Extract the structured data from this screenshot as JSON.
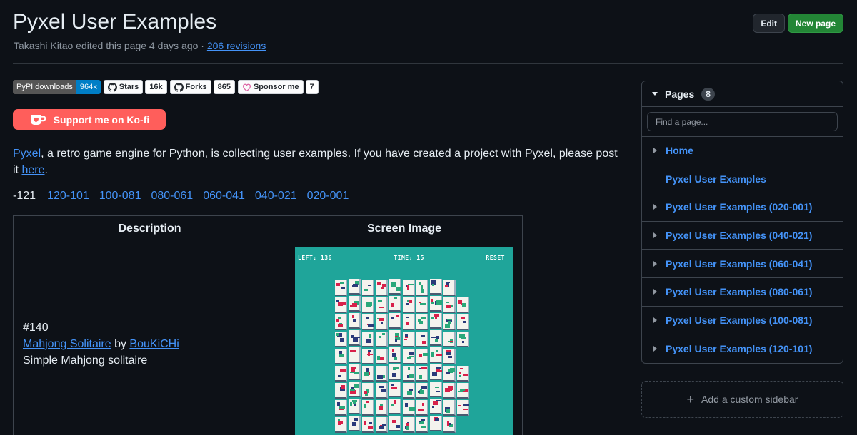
{
  "header": {
    "title": "Pyxel User Examples",
    "edited_by": "Takashi Kitao edited this page 4 days ago · ",
    "revisions": "206 revisions",
    "edit_label": "Edit",
    "new_page_label": "New page"
  },
  "badges": {
    "pypi_label": "PyPI downloads",
    "pypi_value": "964k",
    "stars_label": "Stars",
    "stars_count": "16k",
    "forks_label": "Forks",
    "forks_count": "865",
    "sponsor_label": "Sponsor me",
    "sponsor_count": "7"
  },
  "kofi": {
    "label": "Support me on Ko-fi",
    "color": "#ff5e5b"
  },
  "intro": {
    "link": "Pyxel",
    "text": ", a retro game engine for Python, is collecting user examples. If you have created a project with Pyxel, please post it ",
    "here": "here",
    "end": "."
  },
  "range_nav": {
    "current": "-121",
    "links": [
      "120-101",
      "100-081",
      "080-061",
      "060-041",
      "040-021",
      "020-001"
    ]
  },
  "table": {
    "headers": [
      "Description",
      "Screen Image"
    ],
    "rows": [
      {
        "number": "#140",
        "title": "Mahjong Solitaire",
        "by": " by ",
        "author": "BouKiCHi",
        "description": "Simple Mahjong solitaire",
        "screen": {
          "left": "LEFT: 136",
          "time": "TIME: 15",
          "reset": "RESET",
          "bg_color": "#1fa59a"
        }
      }
    ]
  },
  "sidebar": {
    "title": "Pages",
    "count": "8",
    "search_placeholder": "Find a page...",
    "items": [
      {
        "label": "Home",
        "expandable": true
      },
      {
        "label": "Pyxel User Examples",
        "expandable": false
      },
      {
        "label": "Pyxel User Examples (020-001)",
        "expandable": true
      },
      {
        "label": "Pyxel User Examples (040-021)",
        "expandable": true
      },
      {
        "label": "Pyxel User Examples (060-041)",
        "expandable": true
      },
      {
        "label": "Pyxel User Examples (080-061)",
        "expandable": true
      },
      {
        "label": "Pyxel User Examples (100-081)",
        "expandable": true
      },
      {
        "label": "Pyxel User Examples (120-101)",
        "expandable": true
      }
    ],
    "add_custom": "Add a custom sidebar"
  },
  "colors": {
    "background": "#0d1117",
    "link": "#4493f8",
    "new_page_button": "#238636"
  }
}
